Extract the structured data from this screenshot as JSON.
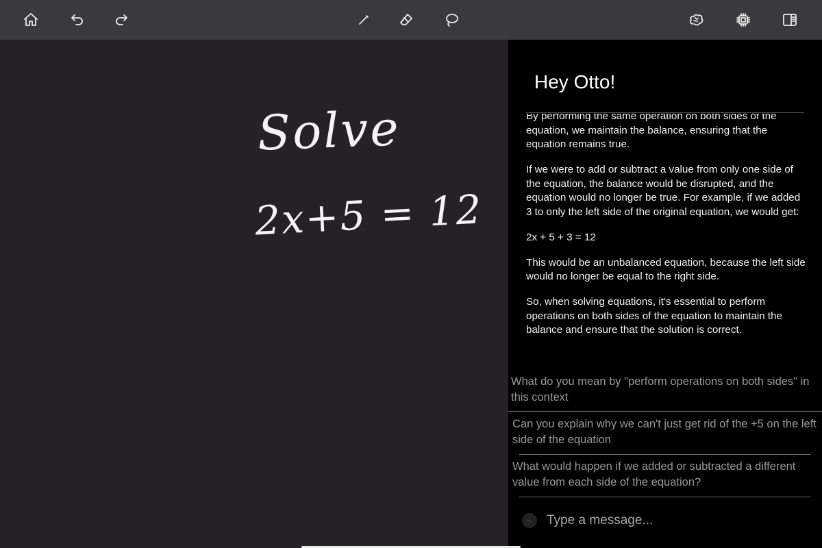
{
  "toolbar": {
    "left_icons": [
      "home-icon",
      "undo-icon",
      "redo-icon"
    ],
    "center_icons": [
      "pen-icon",
      "eraser-icon",
      "lasso-icon"
    ],
    "right_icons": [
      "brain-icon",
      "chip-icon",
      "sidebar-icon"
    ]
  },
  "canvas": {
    "handwriting": [
      "Solve",
      "2x+5 = 12"
    ]
  },
  "chat": {
    "greeting": "Hey Otto!",
    "messages": [
      "By performing the same operation on both sides of the equation, we maintain the balance, ensuring that the equation remains true.",
      "If we were to add or subtract a value from only one side of the equation, the balance would be disrupted, and the equation would no longer be true. For example, if we added 3 to only the left side of the original equation, we would get:",
      "2x + 5 + 3 = 12",
      "This would be an unbalanced equation, because the left side would no longer be equal to the right side.",
      "So, when solving equations, it's essential to perform operations on both sides of the equation to maintain the balance and ensure that the solution is correct."
    ],
    "suggestions": [
      "What do you mean by \"perform operations on both sides\" in this context",
      "Can you explain why we can't just get rid of the +5 on the left side of the equation",
      "What would happen if we added or subtracted a different value from each side of the equation?"
    ],
    "input_placeholder": "Type a message...",
    "attach_icon": "plus-icon"
  },
  "colors": {
    "toolbar_bg": "#3a393b",
    "canvas_bg": "#242224",
    "panel_bg": "#000000",
    "suggestion_text": "#9a9a9a"
  }
}
